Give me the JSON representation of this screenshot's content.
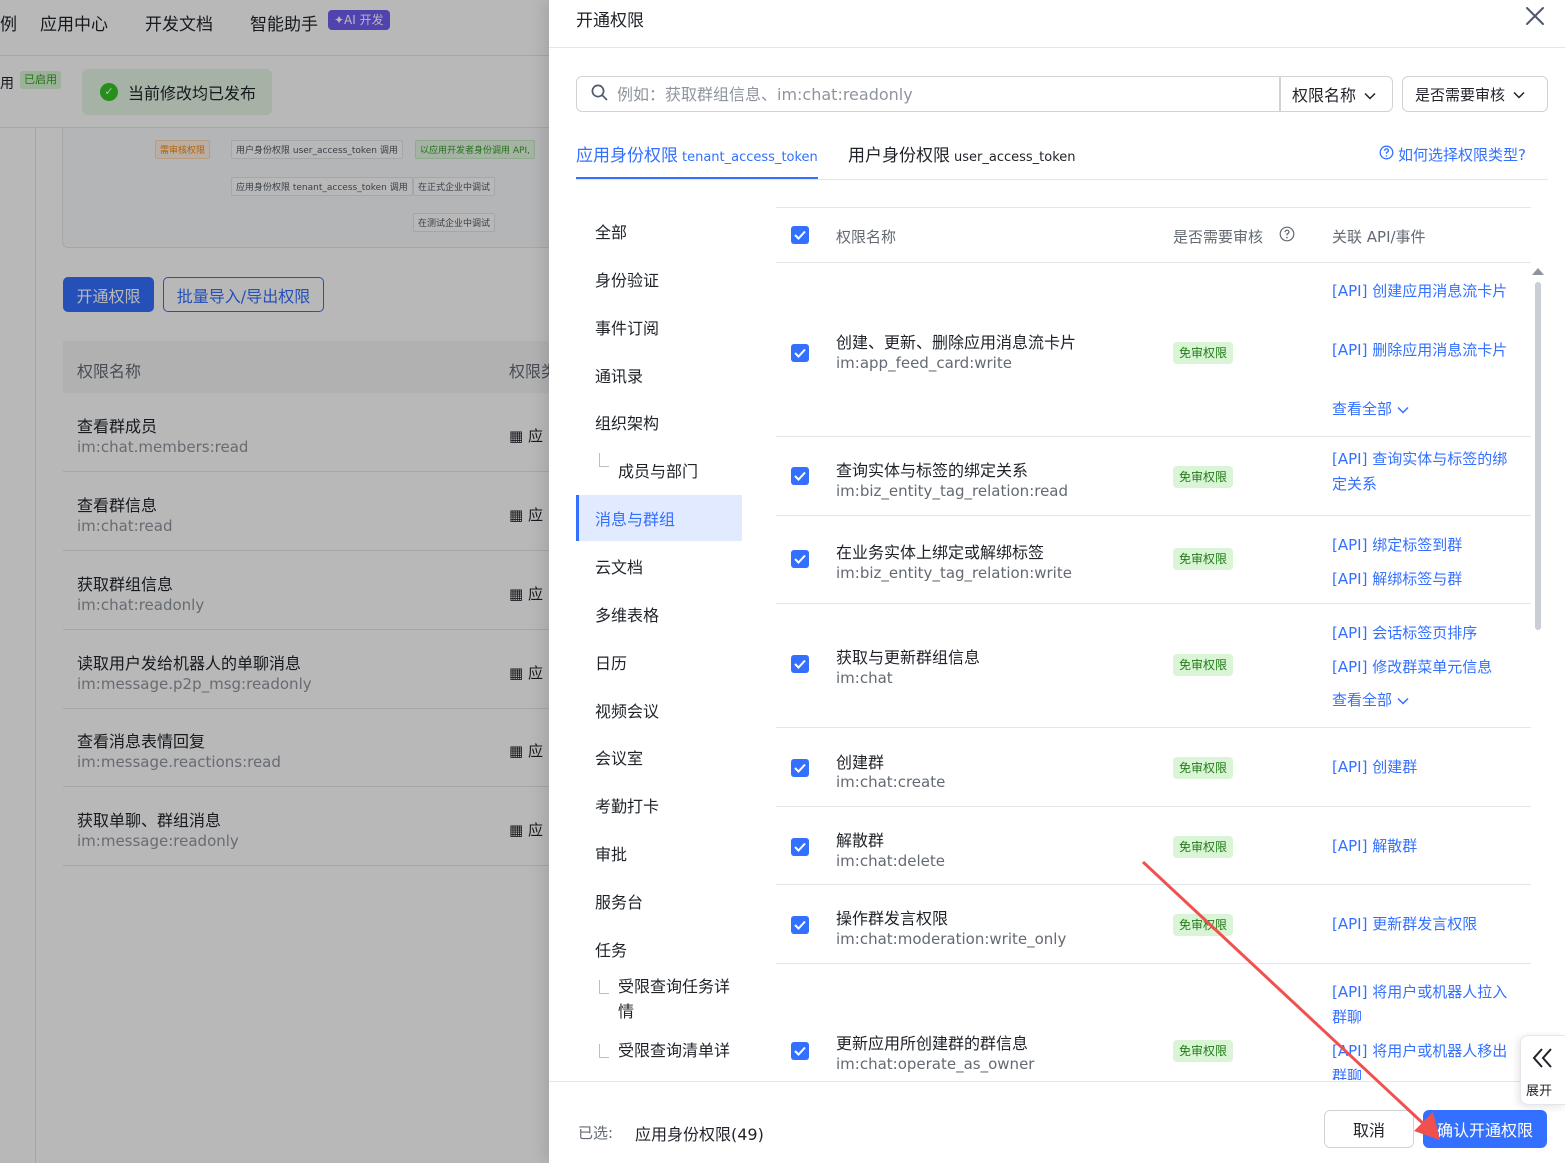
{
  "background": {
    "nav": [
      "例",
      "应用中心",
      "开发文档",
      "智能助手"
    ],
    "ai_badge": "✦AI 开发",
    "enabled_text": "用",
    "enabled_badge": "已启用",
    "published": "当前修改均已发布",
    "diagram": {
      "tag_review": "需审核权限",
      "user_perm": "用户身份权限 user_access_token 调用",
      "app_perm": "应用身份权限 tenant_access_token 调用",
      "dev_call": "以应用开发者身份调用 API,",
      "prod_debug": "在正式企业中调试",
      "test_debug": "在测试企业中调试"
    },
    "btn_open": "开通权限",
    "btn_batch": "批量导入/导出权限",
    "th_name": "权限名称",
    "th_type": "权限类",
    "rows": [
      {
        "name": "查看群成员",
        "code": "im:chat.members:read",
        "type": "应"
      },
      {
        "name": "查看群信息",
        "code": "im:chat:read",
        "type": "应"
      },
      {
        "name": "获取群组信息",
        "code": "im:chat:readonly",
        "type": "应"
      },
      {
        "name": "读取用户发给机器人的单聊消息",
        "code": "im:message.p2p_msg:readonly",
        "type": "应"
      },
      {
        "name": "查看消息表情回复",
        "code": "im:message.reactions:read",
        "type": "应"
      },
      {
        "name": "获取单聊、群组消息",
        "code": "im:message:readonly",
        "type": "应"
      }
    ]
  },
  "drawer": {
    "title": "开通权限",
    "search_placeholder": "例如：获取群组信息、im:chat:readonly",
    "filter_name": "权限名称",
    "filter_review": "是否需要审核",
    "tabs": [
      {
        "label": "应用身份权限",
        "sub": "tenant_access_token"
      },
      {
        "label": "用户身份权限",
        "sub": "user_access_token"
      }
    ],
    "help": "如何选择权限类型?",
    "categories": [
      "全部",
      "身份验证",
      "事件订阅",
      "通讯录",
      "组织架构",
      "成员与部门",
      "消息与群组",
      "云文档",
      "多维表格",
      "日历",
      "视频会议",
      "会议室",
      "考勤打卡",
      "审批",
      "服务台",
      "任务",
      "受限查询任务详情",
      "受限查询清单详"
    ],
    "headers": {
      "name": "权限名称",
      "review": "是否需要审核",
      "api": "关联 API/事件"
    },
    "see_all": "查看全部",
    "perms": [
      {
        "name": "创建、更新、删除应用消息流卡片",
        "code": "im:app_feed_card:write",
        "badge": "免审权限",
        "apis": [
          "[API] 创建应用消息流卡片",
          "[API] 删除应用消息流卡片"
        ]
      },
      {
        "name": "查询实体与标签的绑定关系",
        "code": "im:biz_entity_tag_relation:read",
        "badge": "免审权限",
        "apis": [
          "[API] 查询实体与标签的绑定关系"
        ]
      },
      {
        "name": "在业务实体上绑定或解绑标签",
        "code": "im:biz_entity_tag_relation:write",
        "badge": "免审权限",
        "apis": [
          "[API] 绑定标签到群",
          "[API] 解绑标签与群"
        ]
      },
      {
        "name": "获取与更新群组信息",
        "code": "im:chat",
        "badge": "免审权限",
        "apis": [
          "[API] 会话标签页排序",
          "[API] 修改群菜单元信息"
        ]
      },
      {
        "name": "创建群",
        "code": "im:chat:create",
        "badge": "免审权限",
        "apis": [
          "[API] 创建群"
        ]
      },
      {
        "name": "解散群",
        "code": "im:chat:delete",
        "badge": "免审权限",
        "apis": [
          "[API] 解散群"
        ]
      },
      {
        "name": "操作群发言权限",
        "code": "im:chat:moderation:write_only",
        "badge": "免审权限",
        "apis": [
          "[API] 更新群发言权限"
        ]
      },
      {
        "name": "更新应用所创建群的群信息",
        "code": "im:chat:operate_as_owner",
        "badge": "免审权限",
        "apis": [
          "[API] 将用户或机器人拉入群聊",
          "[API] 将用户或机器人移出群聊"
        ]
      }
    ],
    "footer": {
      "selected_label": "已选:",
      "selected_value": "应用身份权限(49)",
      "cancel": "取消",
      "confirm": "确认开通权限"
    },
    "expand": "展开"
  },
  "colors": {
    "primary": "#3370ff",
    "badge_bg": "#d9f5d6",
    "annotation_arrow": "#f0514f"
  }
}
